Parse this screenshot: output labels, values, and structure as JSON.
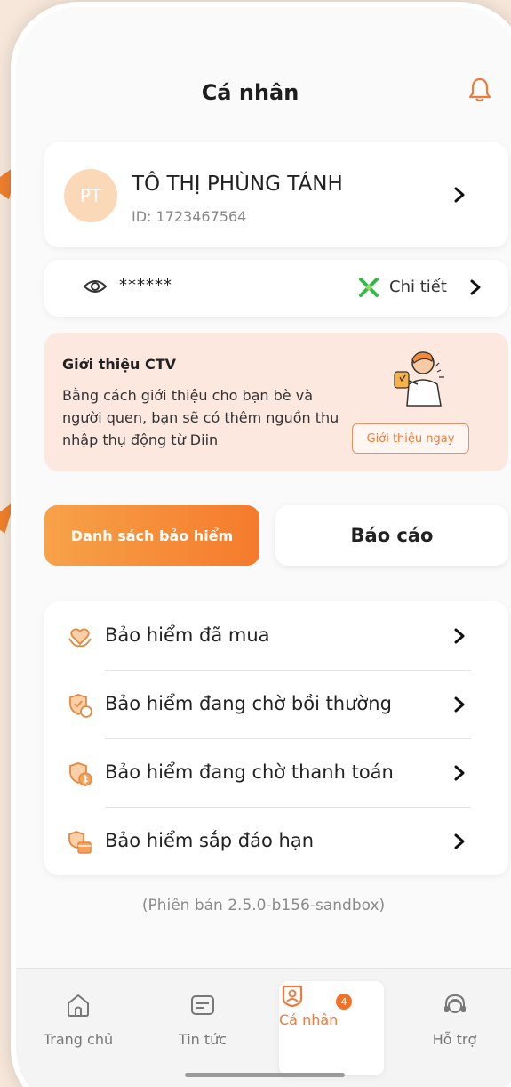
{
  "header": {
    "title": "Cá nhân"
  },
  "profile": {
    "initials": "PT",
    "name": "TÔ THỊ PHÙNG TÁNH",
    "id_text": "ID: 1723467564"
  },
  "balance": {
    "masked_value": "******",
    "detail_label": "Chi tiết"
  },
  "referral": {
    "title": "Giới thiệu CTV",
    "description": "Bằng cách giới thiệu cho bạn bè và người quen, bạn sẽ có thêm nguồn thu nhập thụ động từ Diin",
    "button_label": "Giới thiệu ngay"
  },
  "tabs": {
    "primary": "Danh sách bảo hiểm",
    "secondary": "Báo cáo"
  },
  "insurance_list": [
    {
      "label": "Bảo hiểm đã mua",
      "icon": "heart-hands-icon"
    },
    {
      "label": "Bảo hiểm đang chờ bồi thường",
      "icon": "shield-check-refresh-icon"
    },
    {
      "label": "Bảo hiểm đang chờ thanh toán",
      "icon": "shield-dollar-icon"
    },
    {
      "label": "Bảo hiểm sắp đáo hạn",
      "icon": "calendar-shield-icon"
    }
  ],
  "version": "(Phiên bản 2.5.0-b156-sandbox)",
  "bottom_nav": [
    {
      "label": "Trang chủ",
      "icon": "home-icon"
    },
    {
      "label": "Tin tức",
      "icon": "news-icon"
    },
    {
      "label": "Cá nhân",
      "icon": "profile-icon",
      "badge": "4",
      "active": true
    },
    {
      "label": "Hỗ trợ",
      "icon": "support-icon"
    }
  ],
  "colors": {
    "accent": "#f57a2c",
    "background": "#f6e7da",
    "referral_bg": "#fde8e0"
  }
}
